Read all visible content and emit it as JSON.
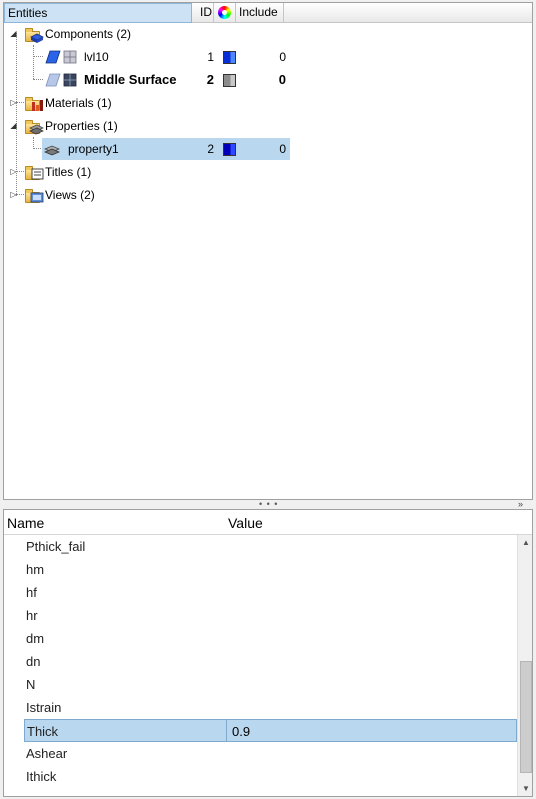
{
  "tree": {
    "columns": {
      "entities": "Entities",
      "id": "ID",
      "color_icon": "color-wheel-icon",
      "include": "Include"
    },
    "rows": [
      {
        "label": "Components (2)",
        "icon": "components-folder-icon",
        "expanded": true
      },
      {
        "label": "lvl10",
        "icon": "component-icon",
        "id": "1",
        "color": "#2060ff",
        "include": "0"
      },
      {
        "label": "Middle Surface",
        "icon": "component-icon",
        "id": "2",
        "color": "#a0a0a0",
        "include": "0",
        "bold": true
      },
      {
        "label": "Materials (1)",
        "icon": "materials-folder-icon",
        "expanded": false
      },
      {
        "label": "Properties (1)",
        "icon": "properties-folder-icon",
        "expanded": true
      },
      {
        "label": "property1",
        "icon": "property-icon",
        "id": "2",
        "color": "#0a1ad0",
        "include": "0",
        "selected": true
      },
      {
        "label": "Titles (1)",
        "icon": "titles-folder-icon",
        "expanded": false
      },
      {
        "label": "Views (2)",
        "icon": "views-folder-icon",
        "expanded": false
      }
    ]
  },
  "splitter": {
    "dots": "• • •",
    "collapse": "»"
  },
  "properties": {
    "columns": {
      "name": "Name",
      "value": "Value"
    },
    "rows": [
      {
        "name": "Pthick_fail",
        "value": ""
      },
      {
        "name": "hm",
        "value": ""
      },
      {
        "name": "hf",
        "value": ""
      },
      {
        "name": "hr",
        "value": ""
      },
      {
        "name": "dm",
        "value": ""
      },
      {
        "name": "dn",
        "value": ""
      },
      {
        "name": "N",
        "value": ""
      },
      {
        "name": "Istrain",
        "value": ""
      },
      {
        "name": "Thick",
        "value": "0.9",
        "selected": true
      },
      {
        "name": "Ashear",
        "value": ""
      },
      {
        "name": "Ithick",
        "value": ""
      }
    ]
  },
  "colors": {
    "selection": "#b9d8ef",
    "header_active": "#cde3f5"
  }
}
